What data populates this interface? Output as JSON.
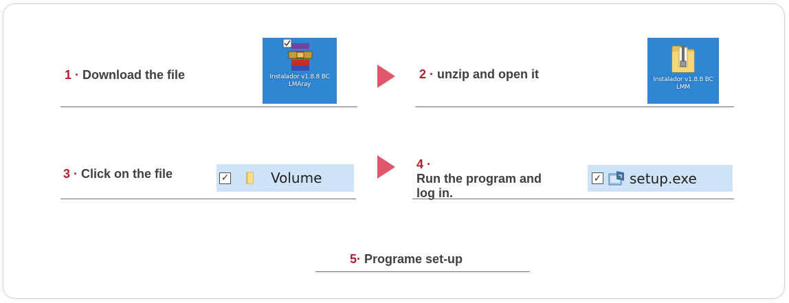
{
  "steps": [
    {
      "num": "1",
      "sep": " · ",
      "text": "Download the file"
    },
    {
      "num": "2",
      "sep": " · ",
      "text": "unzip and open it"
    },
    {
      "num": "3",
      "sep": " · ",
      "text": "Click on the file"
    },
    {
      "num": "4",
      "sep": " · ",
      "text": "Run the program and log in."
    },
    {
      "num": "5",
      "sep": "· ",
      "text": "Programe set-up"
    }
  ],
  "icons": {
    "rar": {
      "name": "archive-icon",
      "caption": "Instalador v1.8.8 BC LMAray"
    },
    "folder": {
      "name": "folder-icon",
      "caption": "Instalador v1.8.8 BC LMM"
    }
  },
  "explorer": {
    "volume": {
      "checked": true,
      "label": "Volume"
    },
    "setup": {
      "checked": true,
      "label": "setup.exe"
    }
  },
  "colors": {
    "accent": "#b01e2e",
    "arrow": "#e0566b",
    "text": "#3f3f3f",
    "tile": "#2f86d3",
    "selection": "#cfe3f8"
  }
}
